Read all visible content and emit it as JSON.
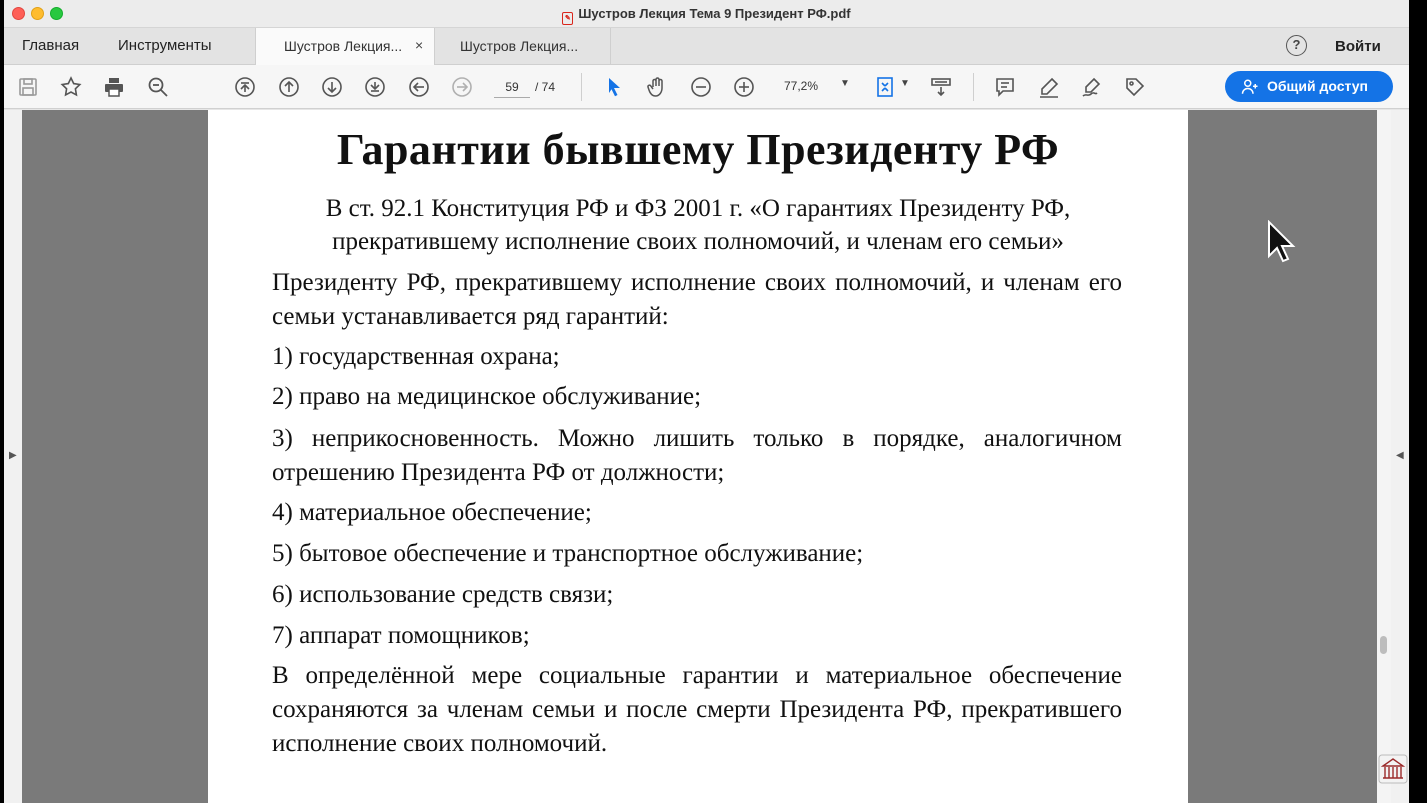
{
  "window": {
    "title": "Шустров Лекция Тема 9 Президент РФ.pdf"
  },
  "tabbar": {
    "home": "Главная",
    "tools": "Инструменты",
    "tabs": [
      {
        "label": "Шустров Лекция...",
        "close": "×"
      },
      {
        "label": "Шустров Лекция..."
      }
    ],
    "help": "?",
    "signin": "Войти"
  },
  "toolbar": {
    "page_current": "59",
    "page_total": "/ 74",
    "zoom": "77,2%",
    "share_label": "Общий доступ",
    "icons": [
      "save-icon",
      "bookmark-star-icon",
      "print-icon",
      "zoom-search-icon",
      "first-page-icon",
      "previous-page-icon",
      "next-page-icon",
      "last-page-icon",
      "back-icon",
      "forward-icon",
      "select-pointer-icon",
      "hand-icon",
      "zoom-out-icon",
      "zoom-in-icon",
      "fit-page-icon",
      "scroll-mode-icon",
      "comment-icon",
      "highlight-pen-icon",
      "sign-icon",
      "stamp-icon"
    ],
    "accent": "#1473e6"
  },
  "document": {
    "title": "Гарантии бывшему Президенту РФ",
    "intro_line1": "В ст. 92.1 Конституция РФ и ФЗ 2001 г. «О гарантиях Президенту РФ,",
    "intro_line2": "прекратившему исполнение своих полномочий, и членам его семьи»",
    "lead": "Президенту РФ, прекратившему исполнение своих полномочий, и членам его семьи устанавливается ряд гарантий:",
    "items": [
      "1) государственная охрана;",
      "2) право на медицинское обслуживание;",
      "3) неприкосновенность. Можно лишить только в порядке, аналогичном отрешению Президента РФ от должности;",
      "4) материальное обеспечение;",
      "5) бытовое обеспечение и транспортное обслуживание;",
      "6) использование средств связи;",
      "7) аппарат помощников;"
    ],
    "closing": "В определённой мере социальные гарантии и материальное обеспечение сохраняются за членам семьи и после смерти Президента РФ, прекратившего исполнение своих полномочий."
  }
}
